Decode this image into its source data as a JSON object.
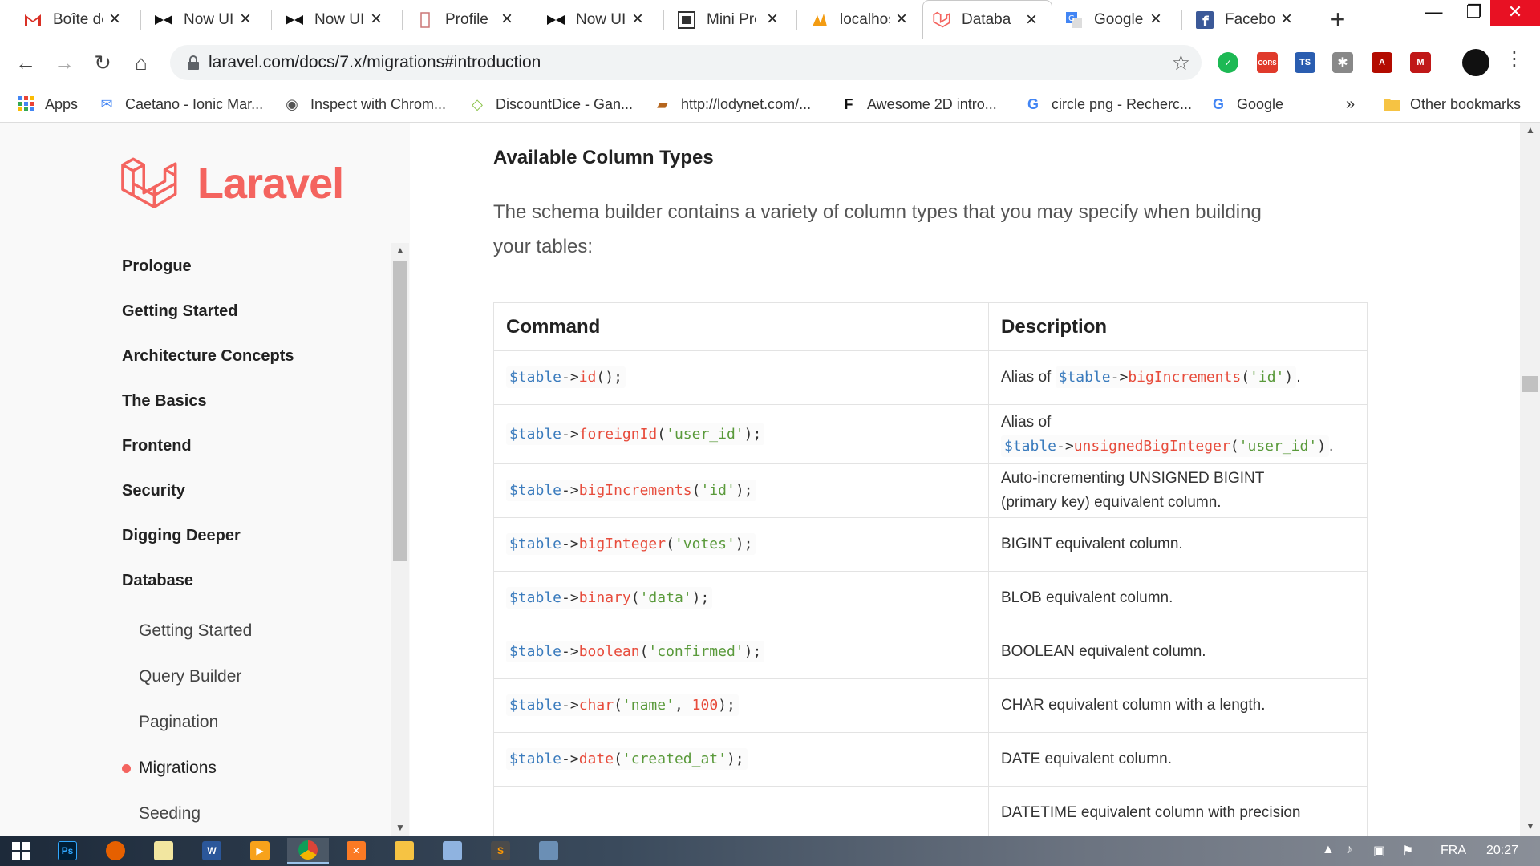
{
  "browser": {
    "tabs": [
      {
        "title": "Boîte de",
        "icon": "gmail-icon",
        "active": false
      },
      {
        "title": "Now UI",
        "icon": "now-ui-icon",
        "active": false
      },
      {
        "title": "Now UI",
        "icon": "now-ui-icon",
        "active": false
      },
      {
        "title": "Profile",
        "icon": "profile-icon",
        "active": false
      },
      {
        "title": "Now UI",
        "icon": "now-ui-icon",
        "active": false
      },
      {
        "title": "Mini Pro",
        "icon": "mini-pro-icon",
        "active": false
      },
      {
        "title": "localhos",
        "icon": "phpmyadmin-icon",
        "active": false
      },
      {
        "title": "Databas",
        "icon": "laravel-icon",
        "active": true
      },
      {
        "title": "Google",
        "icon": "google-translate-icon",
        "active": false
      },
      {
        "title": "Faceboo",
        "icon": "facebook-icon",
        "active": false
      }
    ],
    "new_tab_label": "+",
    "url": "laravel.com/docs/7.x/migrations#introduction",
    "extensions": [
      {
        "name": "check-extension-icon",
        "label": "✓",
        "color": "#1db954"
      },
      {
        "name": "cors-extension-icon",
        "label": "CORS",
        "color": "#e03a2b"
      },
      {
        "name": "ts-extension-icon",
        "label": "TS",
        "color": "#2a5db0"
      },
      {
        "name": "settings-extension-icon",
        "label": "✱",
        "color": "#888888"
      },
      {
        "name": "pdf-extension-icon",
        "label": "A",
        "color": "#b30b00"
      },
      {
        "name": "mcafee-extension-icon",
        "label": "M",
        "color": "#c01818"
      }
    ],
    "bookmarks": [
      {
        "label": "Apps",
        "icon": "apps-grid-icon"
      },
      {
        "label": "Caetano - Ionic Mar...",
        "icon": "mail-icon"
      },
      {
        "label": "Inspect with Chrom...",
        "icon": "globe-icon"
      },
      {
        "label": "DiscountDice - Gan...",
        "icon": "diamond-icon"
      },
      {
        "label": "http://lodynet.com/...",
        "icon": "car-icon"
      },
      {
        "label": "Awesome 2D intro...",
        "icon": "flag-icon"
      },
      {
        "label": "circle png - Recherc...",
        "icon": "google-icon"
      },
      {
        "label": "Google",
        "icon": "google-icon"
      }
    ],
    "bookmarks_more": "»",
    "other_bookmarks": "Other bookmarks"
  },
  "sidebar": {
    "logo_text": "Laravel",
    "sections": [
      "Prologue",
      "Getting Started",
      "Architecture Concepts",
      "The Basics",
      "Frontend",
      "Security",
      "Digging Deeper",
      "Database"
    ],
    "subitems": [
      "Getting Started",
      "Query Builder",
      "Pagination",
      "Migrations",
      "Seeding"
    ],
    "active_subitem": "Migrations"
  },
  "content": {
    "section_title": "Available Column Types",
    "intro": "The schema builder contains a variety of column types that you may specify when building your tables:",
    "table": {
      "headers": [
        "Command",
        "Description"
      ],
      "rows": [
        {
          "command": [
            [
              "v",
              "$table"
            ],
            [
              "p",
              "->"
            ],
            [
              "m",
              "id"
            ],
            [
              "p",
              "();"
            ]
          ],
          "description": [
            [
              [
                "t",
                "Alias of "
              ],
              [
                "v",
                "$table"
              ],
              [
                "p",
                "->"
              ],
              [
                "m",
                "bigIncrements"
              ],
              [
                "p",
                "("
              ],
              [
                "s",
                "'id'"
              ],
              [
                "p",
                ")"
              ],
              [
                "t",
                "."
              ]
            ]
          ]
        },
        {
          "command": [
            [
              "v",
              "$table"
            ],
            [
              "p",
              "->"
            ],
            [
              "m",
              "foreignId"
            ],
            [
              "p",
              "("
            ],
            [
              "s",
              "'user_id'"
            ],
            [
              "p",
              ");"
            ]
          ],
          "description": [
            [
              [
                "t",
                "Alias of"
              ]
            ],
            [
              [
                "v",
                "$table"
              ],
              [
                "p",
                "->"
              ],
              [
                "m",
                "unsignedBigInteger"
              ],
              [
                "p",
                "("
              ],
              [
                "s",
                "'user_id'"
              ],
              [
                "p",
                ")"
              ],
              [
                "t",
                "."
              ]
            ]
          ]
        },
        {
          "command": [
            [
              "v",
              "$table"
            ],
            [
              "p",
              "->"
            ],
            [
              "m",
              "bigIncrements"
            ],
            [
              "p",
              "("
            ],
            [
              "s",
              "'id'"
            ],
            [
              "p",
              ");"
            ]
          ],
          "description": [
            [
              [
                "t",
                "Auto-incrementing UNSIGNED BIGINT"
              ]
            ],
            [
              [
                "t",
                "(primary key) equivalent column."
              ]
            ]
          ]
        },
        {
          "command": [
            [
              "v",
              "$table"
            ],
            [
              "p",
              "->"
            ],
            [
              "m",
              "bigInteger"
            ],
            [
              "p",
              "("
            ],
            [
              "s",
              "'votes'"
            ],
            [
              "p",
              ");"
            ]
          ],
          "description": [
            [
              [
                "t",
                "BIGINT equivalent column."
              ]
            ]
          ]
        },
        {
          "command": [
            [
              "v",
              "$table"
            ],
            [
              "p",
              "->"
            ],
            [
              "m",
              "binary"
            ],
            [
              "p",
              "("
            ],
            [
              "s",
              "'data'"
            ],
            [
              "p",
              ");"
            ]
          ],
          "description": [
            [
              [
                "t",
                "BLOB equivalent column."
              ]
            ]
          ]
        },
        {
          "command": [
            [
              "v",
              "$table"
            ],
            [
              "p",
              "->"
            ],
            [
              "m",
              "boolean"
            ],
            [
              "p",
              "("
            ],
            [
              "s",
              "'confirmed'"
            ],
            [
              "p",
              ");"
            ]
          ],
          "description": [
            [
              [
                "t",
                "BOOLEAN equivalent column."
              ]
            ]
          ]
        },
        {
          "command": [
            [
              "v",
              "$table"
            ],
            [
              "p",
              "->"
            ],
            [
              "m",
              "char"
            ],
            [
              "p",
              "("
            ],
            [
              "s",
              "'name'"
            ],
            [
              "p",
              ", "
            ],
            [
              "n",
              "100"
            ],
            [
              "p",
              ");"
            ]
          ],
          "description": [
            [
              [
                "t",
                "CHAR equivalent column with a length."
              ]
            ]
          ]
        },
        {
          "command": [
            [
              "v",
              "$table"
            ],
            [
              "p",
              "->"
            ],
            [
              "m",
              "date"
            ],
            [
              "p",
              "("
            ],
            [
              "s",
              "'created_at'"
            ],
            [
              "p",
              ");"
            ]
          ],
          "description": [
            [
              [
                "t",
                "DATE equivalent column."
              ]
            ]
          ]
        },
        {
          "command": [],
          "description": [
            [
              [
                "t",
                "DATETIME equivalent column with precision"
              ]
            ]
          ]
        }
      ]
    }
  },
  "taskbar": {
    "apps": [
      "start-icon",
      "photoshop-icon",
      "firefox-icon",
      "notepad-icon",
      "word-icon",
      "media-player-icon",
      "chrome-icon",
      "xampp-icon",
      "file-explorer-icon",
      "paint-icon",
      "sublime-icon",
      "window-app-icon"
    ],
    "language": "FRA",
    "time": "20:27"
  }
}
